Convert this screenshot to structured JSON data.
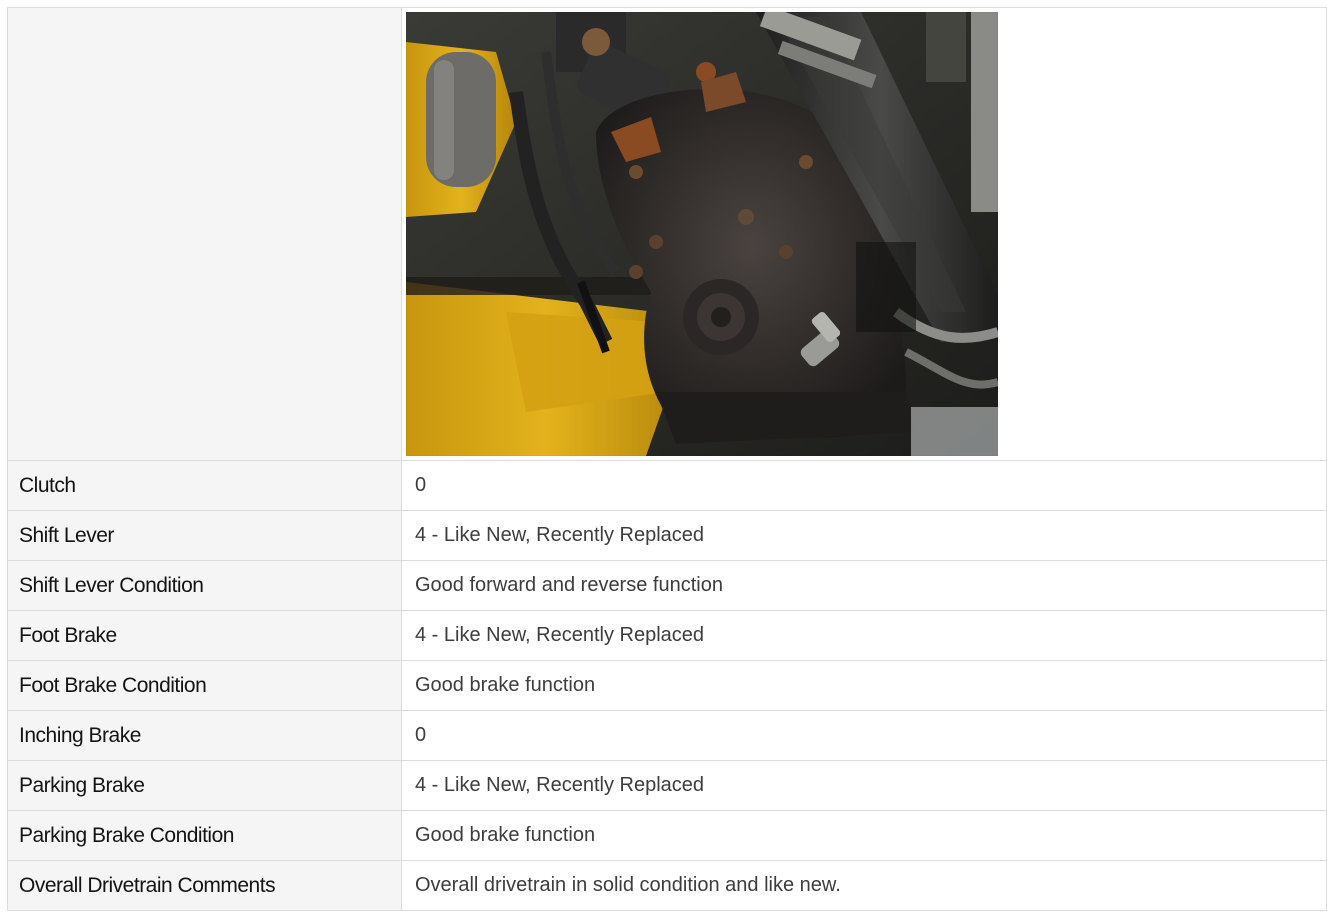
{
  "photo": {
    "alt": "Drivetrain underside photo",
    "colors": {
      "frame_yellow": "#d9a511",
      "housing_black": "#262626",
      "hose_dark": "#2b2b2b",
      "rust": "#8a4a22"
    }
  },
  "rows": [
    {
      "label": "Clutch",
      "value": "0"
    },
    {
      "label": "Shift Lever",
      "value": "4 - Like New, Recently Replaced"
    },
    {
      "label": "Shift Lever Condition",
      "value": "Good forward and reverse function"
    },
    {
      "label": "Foot Brake",
      "value": "4 - Like New, Recently Replaced"
    },
    {
      "label": "Foot Brake Condition",
      "value": "Good brake function"
    },
    {
      "label": "Inching Brake",
      "value": "0"
    },
    {
      "label": "Parking Brake",
      "value": "4 - Like New, Recently Replaced"
    },
    {
      "label": "Parking Brake Condition",
      "value": "Good brake function"
    },
    {
      "label": "Overall Drivetrain Comments",
      "value": "Overall drivetrain in solid condition and like new."
    }
  ]
}
